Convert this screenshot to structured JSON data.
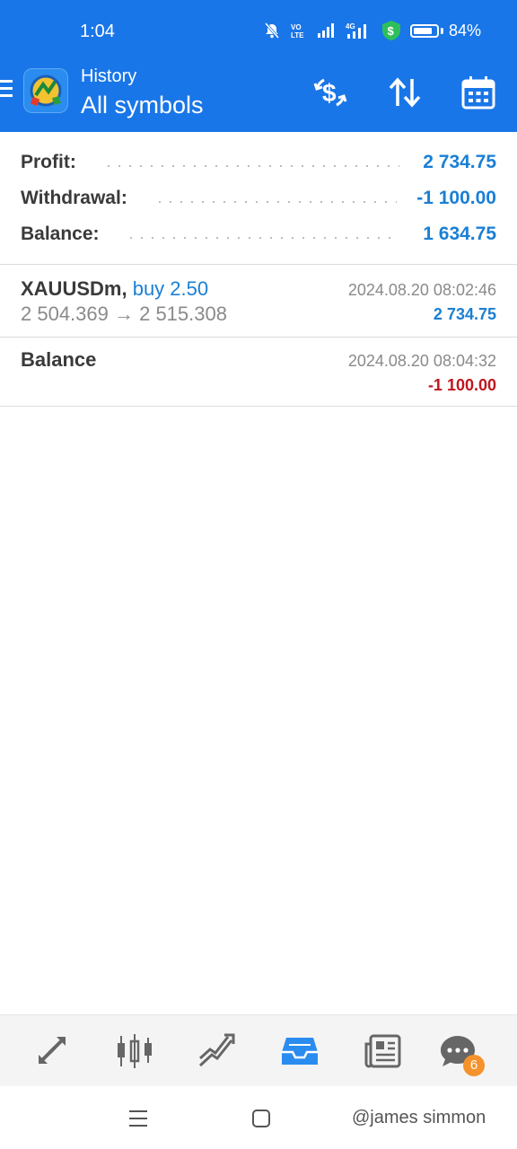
{
  "status_bar": {
    "time": "1:04",
    "battery_percent": "84%",
    "battery_level": 0.84,
    "icons": [
      "bell-muted-icon",
      "volte-icon",
      "signal-icon",
      "signal-4g-icon",
      "money-shield-icon",
      "battery-icon"
    ]
  },
  "header": {
    "subtitle": "History",
    "title": "All symbols",
    "actions": [
      "currency-exchange-icon",
      "sort-icon",
      "calendar-icon"
    ]
  },
  "summary": {
    "profit_label": "Profit:",
    "profit_value": "2 734.75",
    "withdrawal_label": "Withdrawal:",
    "withdrawal_value": "-1 100.00",
    "balance_label": "Balance:",
    "balance_value": "1 634.75"
  },
  "deals": [
    {
      "symbol": "XAUUSDm,",
      "type": "buy 2.50",
      "prices": "2 504.369 → 2 515.308",
      "time": "2024.08.20 08:02:46",
      "profit": "2 734.75"
    },
    {
      "symbol": "Balance",
      "type": "",
      "prices": "",
      "time": "2024.08.20 08:04:32",
      "profit": "-1 100.00"
    }
  ],
  "bottom_nav": {
    "items": [
      "quotes-icon",
      "chart-icon",
      "trade-icon",
      "history-icon",
      "news-icon",
      "chat-icon"
    ],
    "active": "history-icon",
    "chat_badge": "6"
  },
  "system_nav": {
    "watermark": "@james simmon"
  },
  "colors": {
    "header_blue": "#1976e8",
    "positive": "#1a7fd4",
    "negative": "#c0161d",
    "badge": "#f5922b"
  }
}
